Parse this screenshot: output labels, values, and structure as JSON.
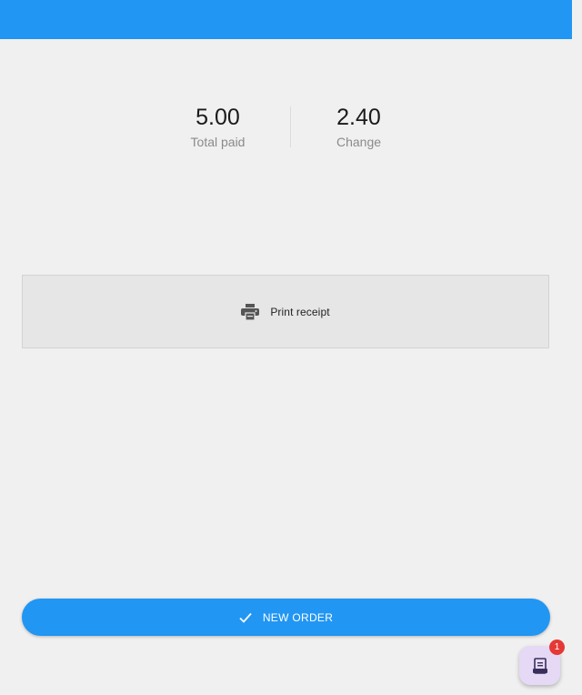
{
  "summary": {
    "total_paid_value": "5.00",
    "total_paid_label": "Total paid",
    "change_value": "2.40",
    "change_label": "Change"
  },
  "print": {
    "label": "Print receipt",
    "icon": "printer-icon"
  },
  "new_order": {
    "label": "NEW ORDER",
    "icon": "check-icon"
  },
  "fab": {
    "icon": "receipt-icon",
    "badge_count": "1"
  },
  "colors": {
    "primary": "#2196f3",
    "background": "#f0f0f0",
    "fab_background": "#e5d9f5",
    "badge": "#e53935"
  }
}
